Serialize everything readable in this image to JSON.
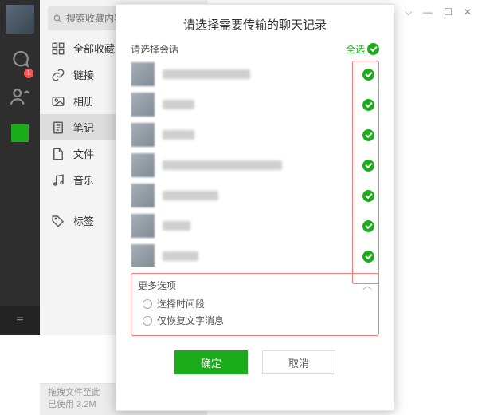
{
  "rail": {
    "badge": "1"
  },
  "search": {
    "placeholder": "搜索收藏内容"
  },
  "categories": [
    {
      "icon": "grid",
      "label": "全部收藏"
    },
    {
      "icon": "link",
      "label": "链接"
    },
    {
      "icon": "image",
      "label": "相册"
    },
    {
      "icon": "note",
      "label": "笔记"
    },
    {
      "icon": "file",
      "label": "文件"
    },
    {
      "icon": "music",
      "label": "音乐"
    },
    {
      "icon": "tag",
      "label": "标签"
    }
  ],
  "active_index": 3,
  "footer": {
    "line1": "拖拽文件至此",
    "line2": "已使用 3.2M"
  },
  "modal": {
    "title": "请选择需要传输的聊天记录",
    "subtitle": "请选择会话",
    "select_all": "全选",
    "more": "更多选项",
    "opt1": "选择时间段",
    "opt2": "仅恢复文字消息",
    "ok": "确定",
    "cancel": "取消"
  }
}
